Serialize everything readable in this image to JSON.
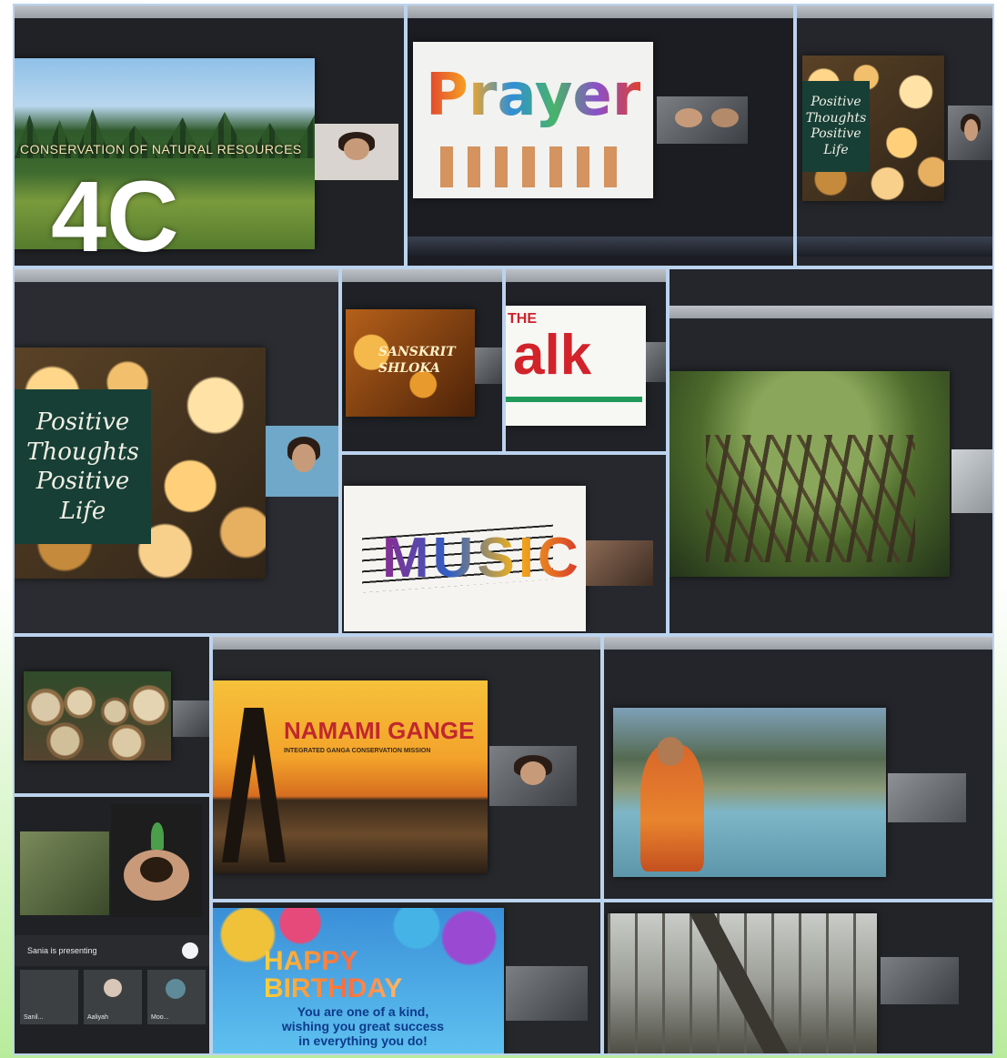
{
  "collage": {
    "class_label": "4C",
    "tiles": {
      "conservation": {
        "slide_title": "CONSERVATION OF NATURAL RESOURCES"
      },
      "prayer": {
        "slide_title": "Prayer"
      },
      "positive_small": {
        "lines": [
          "Positive",
          "Thoughts",
          "Positive",
          "Life"
        ]
      },
      "positive_large": {
        "lines": [
          "Positive",
          "Thoughts",
          "Positive",
          "Life"
        ]
      },
      "sanskrit": {
        "slide_title": "SANSKRIT SHLOKA"
      },
      "talk": {
        "prefix": "THE",
        "word": "alk"
      },
      "music": {
        "word": "MUSIC"
      },
      "namami": {
        "title": "NAMAMI GANGE",
        "subtitle": "INTEGRATED GANGA CONSERVATION MISSION"
      },
      "meet": {
        "presenting": "Sania is presenting",
        "participants": [
          "Sanil...",
          "Aaliyah",
          "Moo..."
        ]
      },
      "birthday": {
        "title": "HAPPY BIRTHDAY",
        "message_lines": [
          "You are one of a kind,",
          "wishing you great success",
          "in everything you do!"
        ]
      }
    },
    "colors": {
      "tile_border": "#bcd3ee",
      "background_bottom": "#b8ec9c",
      "namami_title": "#c1272d"
    }
  }
}
